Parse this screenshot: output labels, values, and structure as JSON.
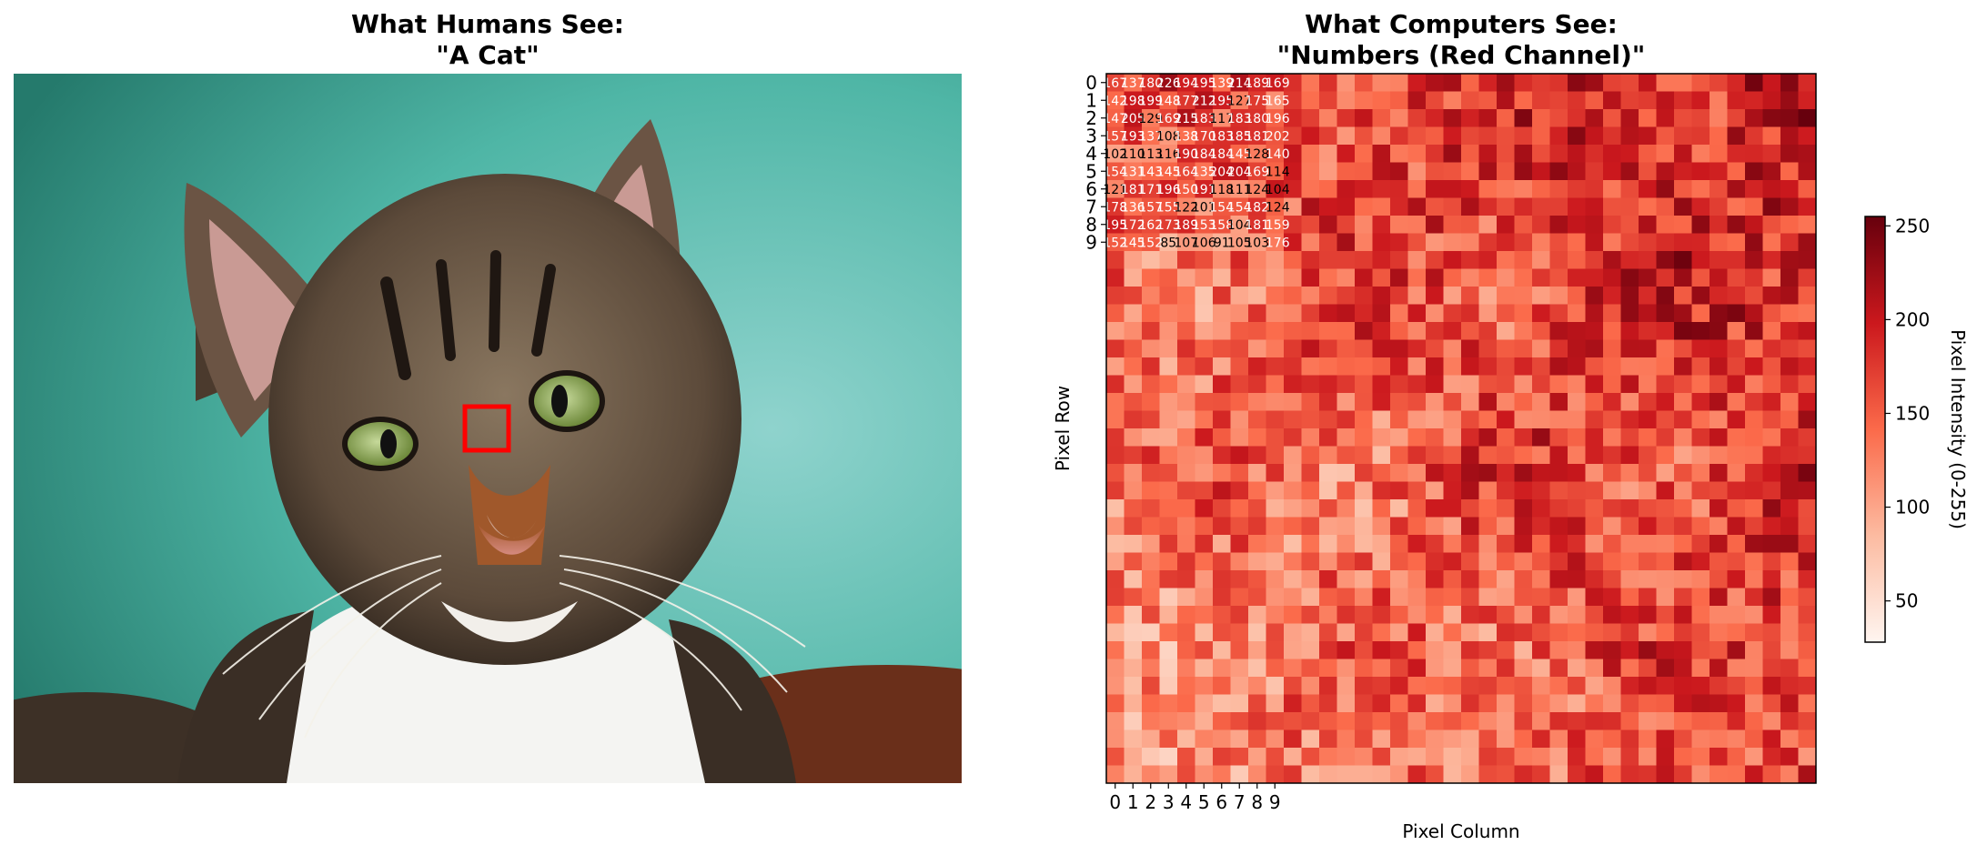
{
  "left_panel": {
    "title_line1": "What Humans See:",
    "title_line2": "\"A Cat\""
  },
  "chart_data": {
    "type": "heatmap",
    "title_line1": "What Computers See:",
    "title_line2": "\"Numbers (Red Channel)\"",
    "xlabel": "Pixel Column",
    "ylabel": "Pixel Row",
    "colorbar_label": "Pixel Intensity (0-255)",
    "colormap": "Reds",
    "colorbar_range": [
      28,
      255
    ],
    "colorbar_ticks": [
      50,
      100,
      150,
      200,
      250
    ],
    "x_ticks": [
      "0",
      "1",
      "2",
      "3",
      "4",
      "5",
      "6",
      "7",
      "8",
      "9"
    ],
    "y_ticks": [
      "0",
      "1",
      "2",
      "3",
      "4",
      "5",
      "6",
      "7",
      "8",
      "9"
    ],
    "grid_cols": 40,
    "grid_rows": 40,
    "annotated_values_last_column": [
      169,
      165,
      196,
      202,
      140,
      114,
      104,
      124,
      159,
      176
    ]
  },
  "colors": {
    "highlight_box": "#ff0000",
    "text": "#000000"
  }
}
